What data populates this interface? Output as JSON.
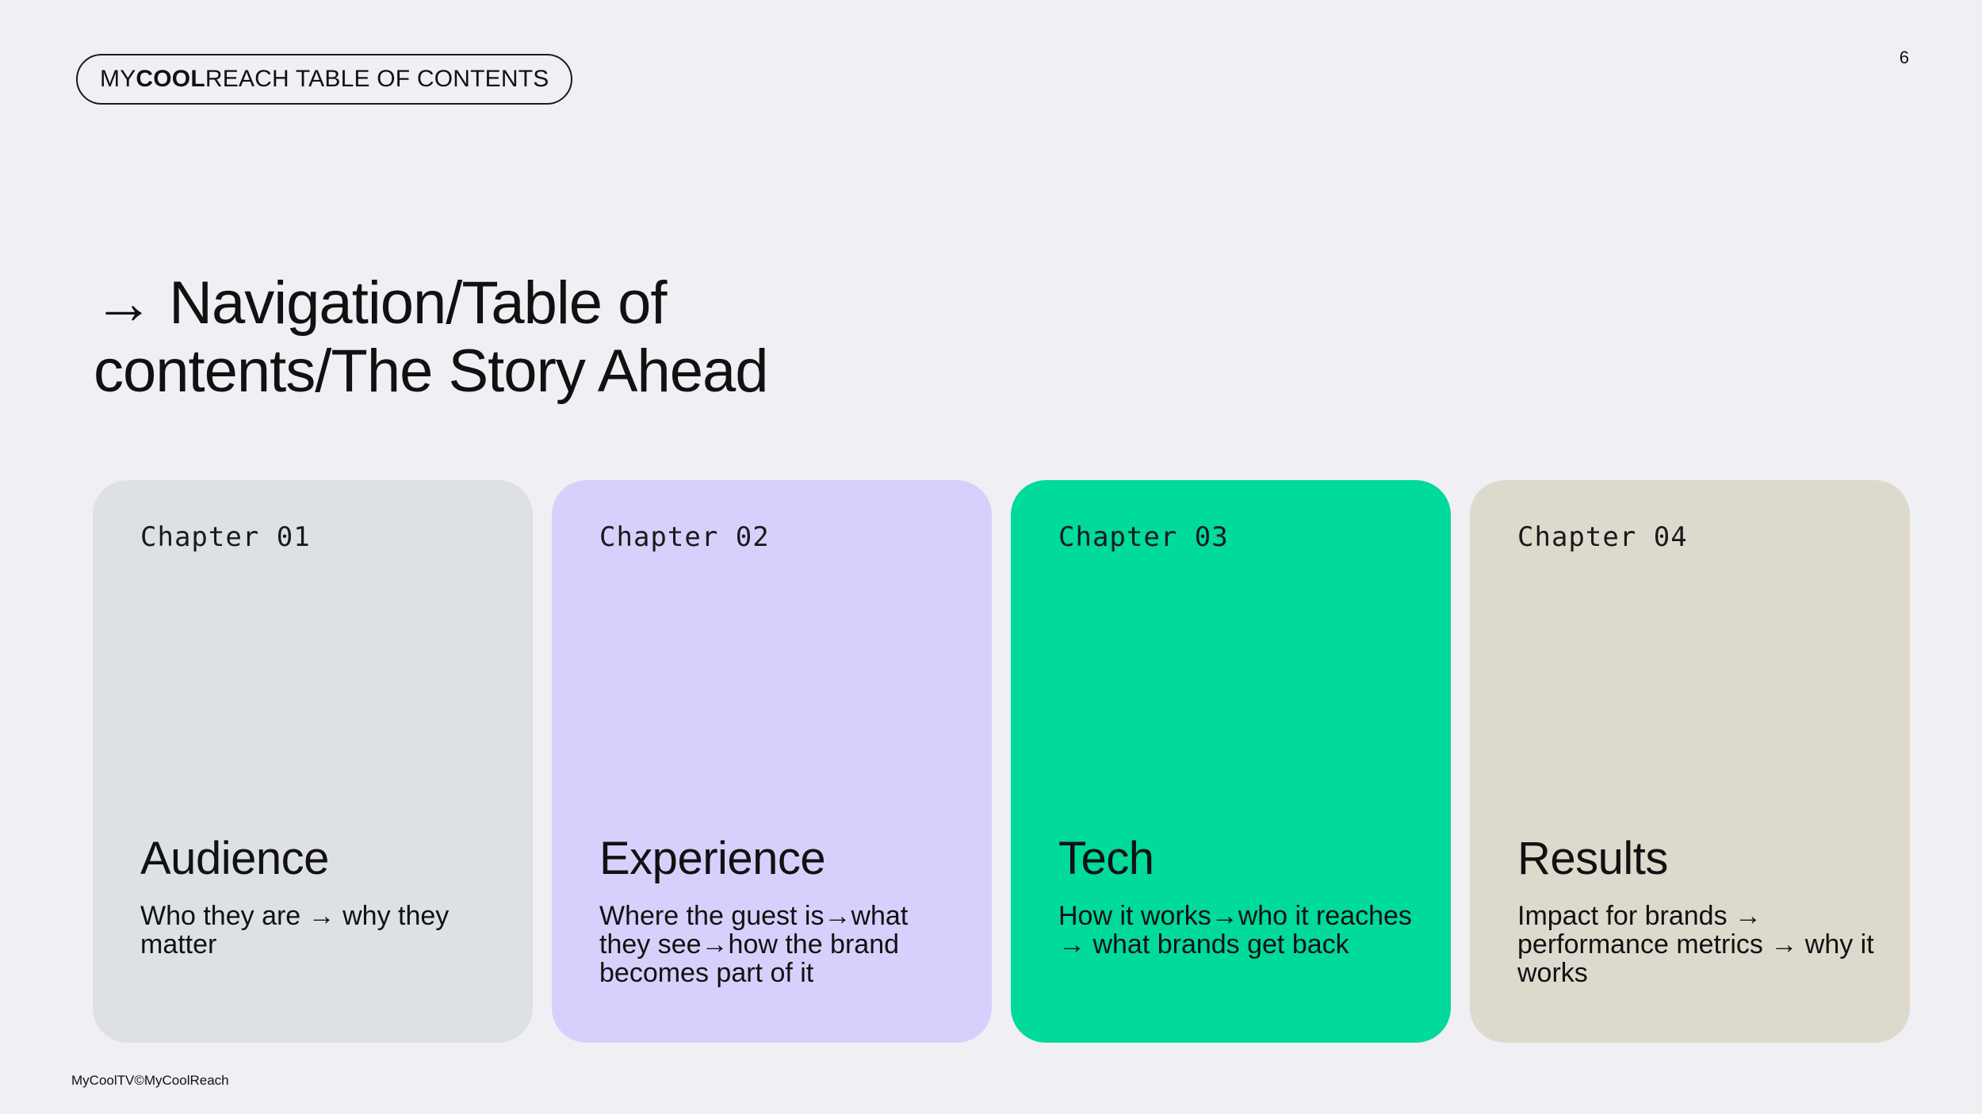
{
  "header": {
    "pill_prefix": "MY",
    "pill_bold": "COOL",
    "pill_suffix": "REACH TABLE OF CONTENTS",
    "page_number": "6"
  },
  "title": {
    "arrow": "→",
    "text": "Navigation/Table of contents/The Story Ahead"
  },
  "cards": [
    {
      "chapter": "Chapter 01",
      "heading": "Audience",
      "description": "Who they are → why they matter",
      "color": "#DDE0E5"
    },
    {
      "chapter": "Chapter 02",
      "heading": "Experience",
      "description": "Where the guest is→what they see→how the brand becomes part of it",
      "color": "#D9CFFC"
    },
    {
      "chapter": "Chapter 03",
      "heading": "Tech",
      "description": "How it works→who it reaches → what brands get back",
      "color": "#00DA9A"
    },
    {
      "chapter": "Chapter 04",
      "heading": "Results",
      "description": "Impact for brands → performance metrics → why it works",
      "color": "#DDD9CD"
    }
  ],
  "footer": {
    "text": "MyCoolTV©MyCoolReach"
  },
  "colors": {
    "background": "#F0EFF3",
    "text": "#111111"
  }
}
